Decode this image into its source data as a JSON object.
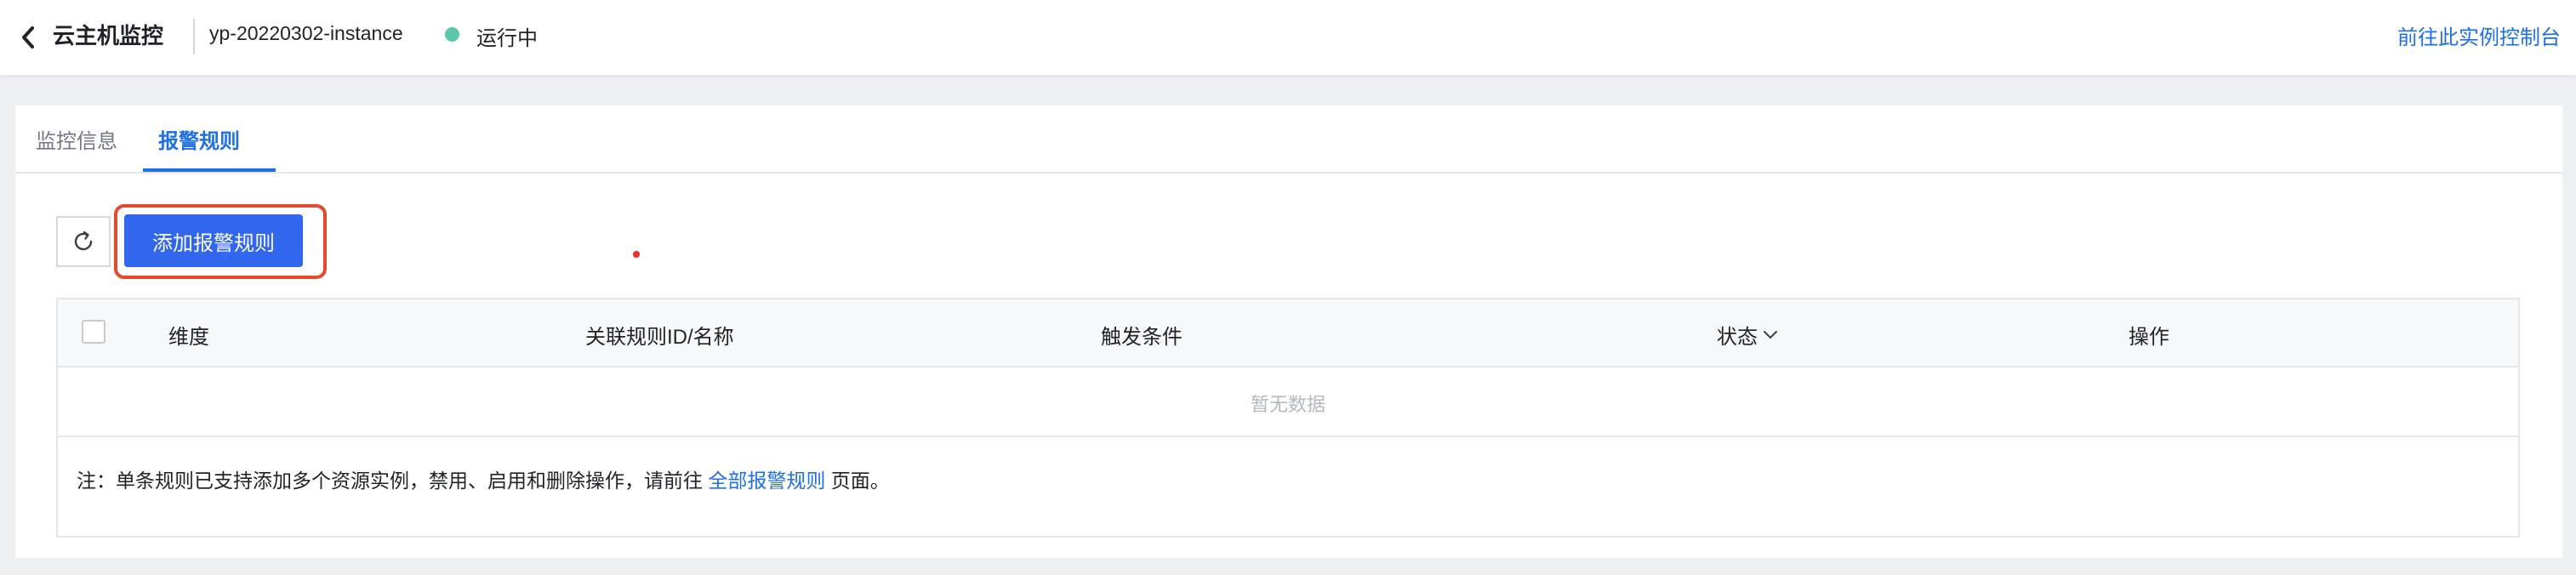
{
  "header": {
    "title": "云主机监控",
    "instance_name": "yp-20220302-instance",
    "status": "运行中",
    "status_color": "#5cc8a8",
    "console_link": "前往此实例控制台",
    "back_icon": "chevron-left-icon"
  },
  "tabs": [
    {
      "label": "监控信息",
      "active": false
    },
    {
      "label": "报警规则",
      "active": true
    }
  ],
  "toolbar": {
    "refresh_icon": "refresh-icon",
    "add_button_label": "添加报警规则"
  },
  "table": {
    "columns": [
      "维度",
      "关联规则ID/名称",
      "触发条件",
      "状态",
      "操作"
    ],
    "empty_text": "暂无数据",
    "note_prefix": "注：单条规则已支持添加多个资源实例，禁用、启用和删除操作，请前往",
    "note_link": "全部报警规则",
    "note_suffix": "页面。"
  },
  "colors": {
    "accent": "#1f6fe6",
    "button": "#3166ee",
    "highlight": "#e64a2e"
  }
}
